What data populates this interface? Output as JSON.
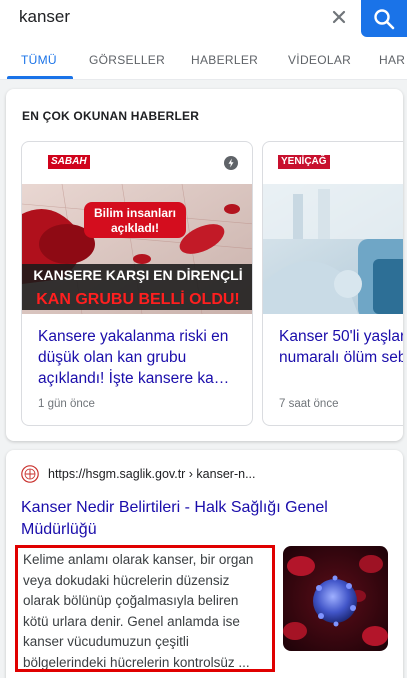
{
  "search": {
    "query": "kanser"
  },
  "tabs": [
    {
      "label": "TÜMÜ",
      "active": true
    },
    {
      "label": "GÖRSELLER"
    },
    {
      "label": "HABERLER"
    },
    {
      "label": "VİDEOLAR"
    },
    {
      "label": "HAR"
    }
  ],
  "news": {
    "heading": "EN ÇOK OKUNAN HABERLER",
    "stories": [
      {
        "source": "SABAH",
        "image_lines": [
          "Bilim insanları",
          "açıkladı!",
          "KANSERE KARŞI EN DİRENÇLİ",
          "KAN GRUBU BELLİ OLDU!"
        ],
        "title": "Kansere yakalanma riski en düşük olan kan grubu açıklandı! İşte kansere ka…",
        "time": "1 gün önce"
      },
      {
        "source": "YENİÇAĞ",
        "title_lines": [
          "Kanser 50'li yaşlar",
          "numaralı ölüm seb"
        ],
        "time": "7 saat önce"
      }
    ]
  },
  "result": {
    "url": "https://hsgm.saglik.gov.tr › kanser-n...",
    "title": "Kanser Nedir Belirtileri - Halk Sağlığı Genel Müdürlüğü",
    "snippet": "Kelime anlamı olarak kanser, bir organ veya dokudaki hücrelerin düzensiz olarak bölünüp çoğalmasıyla beliren kötü urlara denir. Genel anlamda ise kanser vücudumuzun çeşitli bölgelerindeki hücrelerin kontrolsüz ..."
  },
  "colors": {
    "accent": "#1a73e8",
    "link": "#1a0dab",
    "highlight": "#e00000",
    "sabah": "#d0021b",
    "yenicag": "#c8102e"
  }
}
